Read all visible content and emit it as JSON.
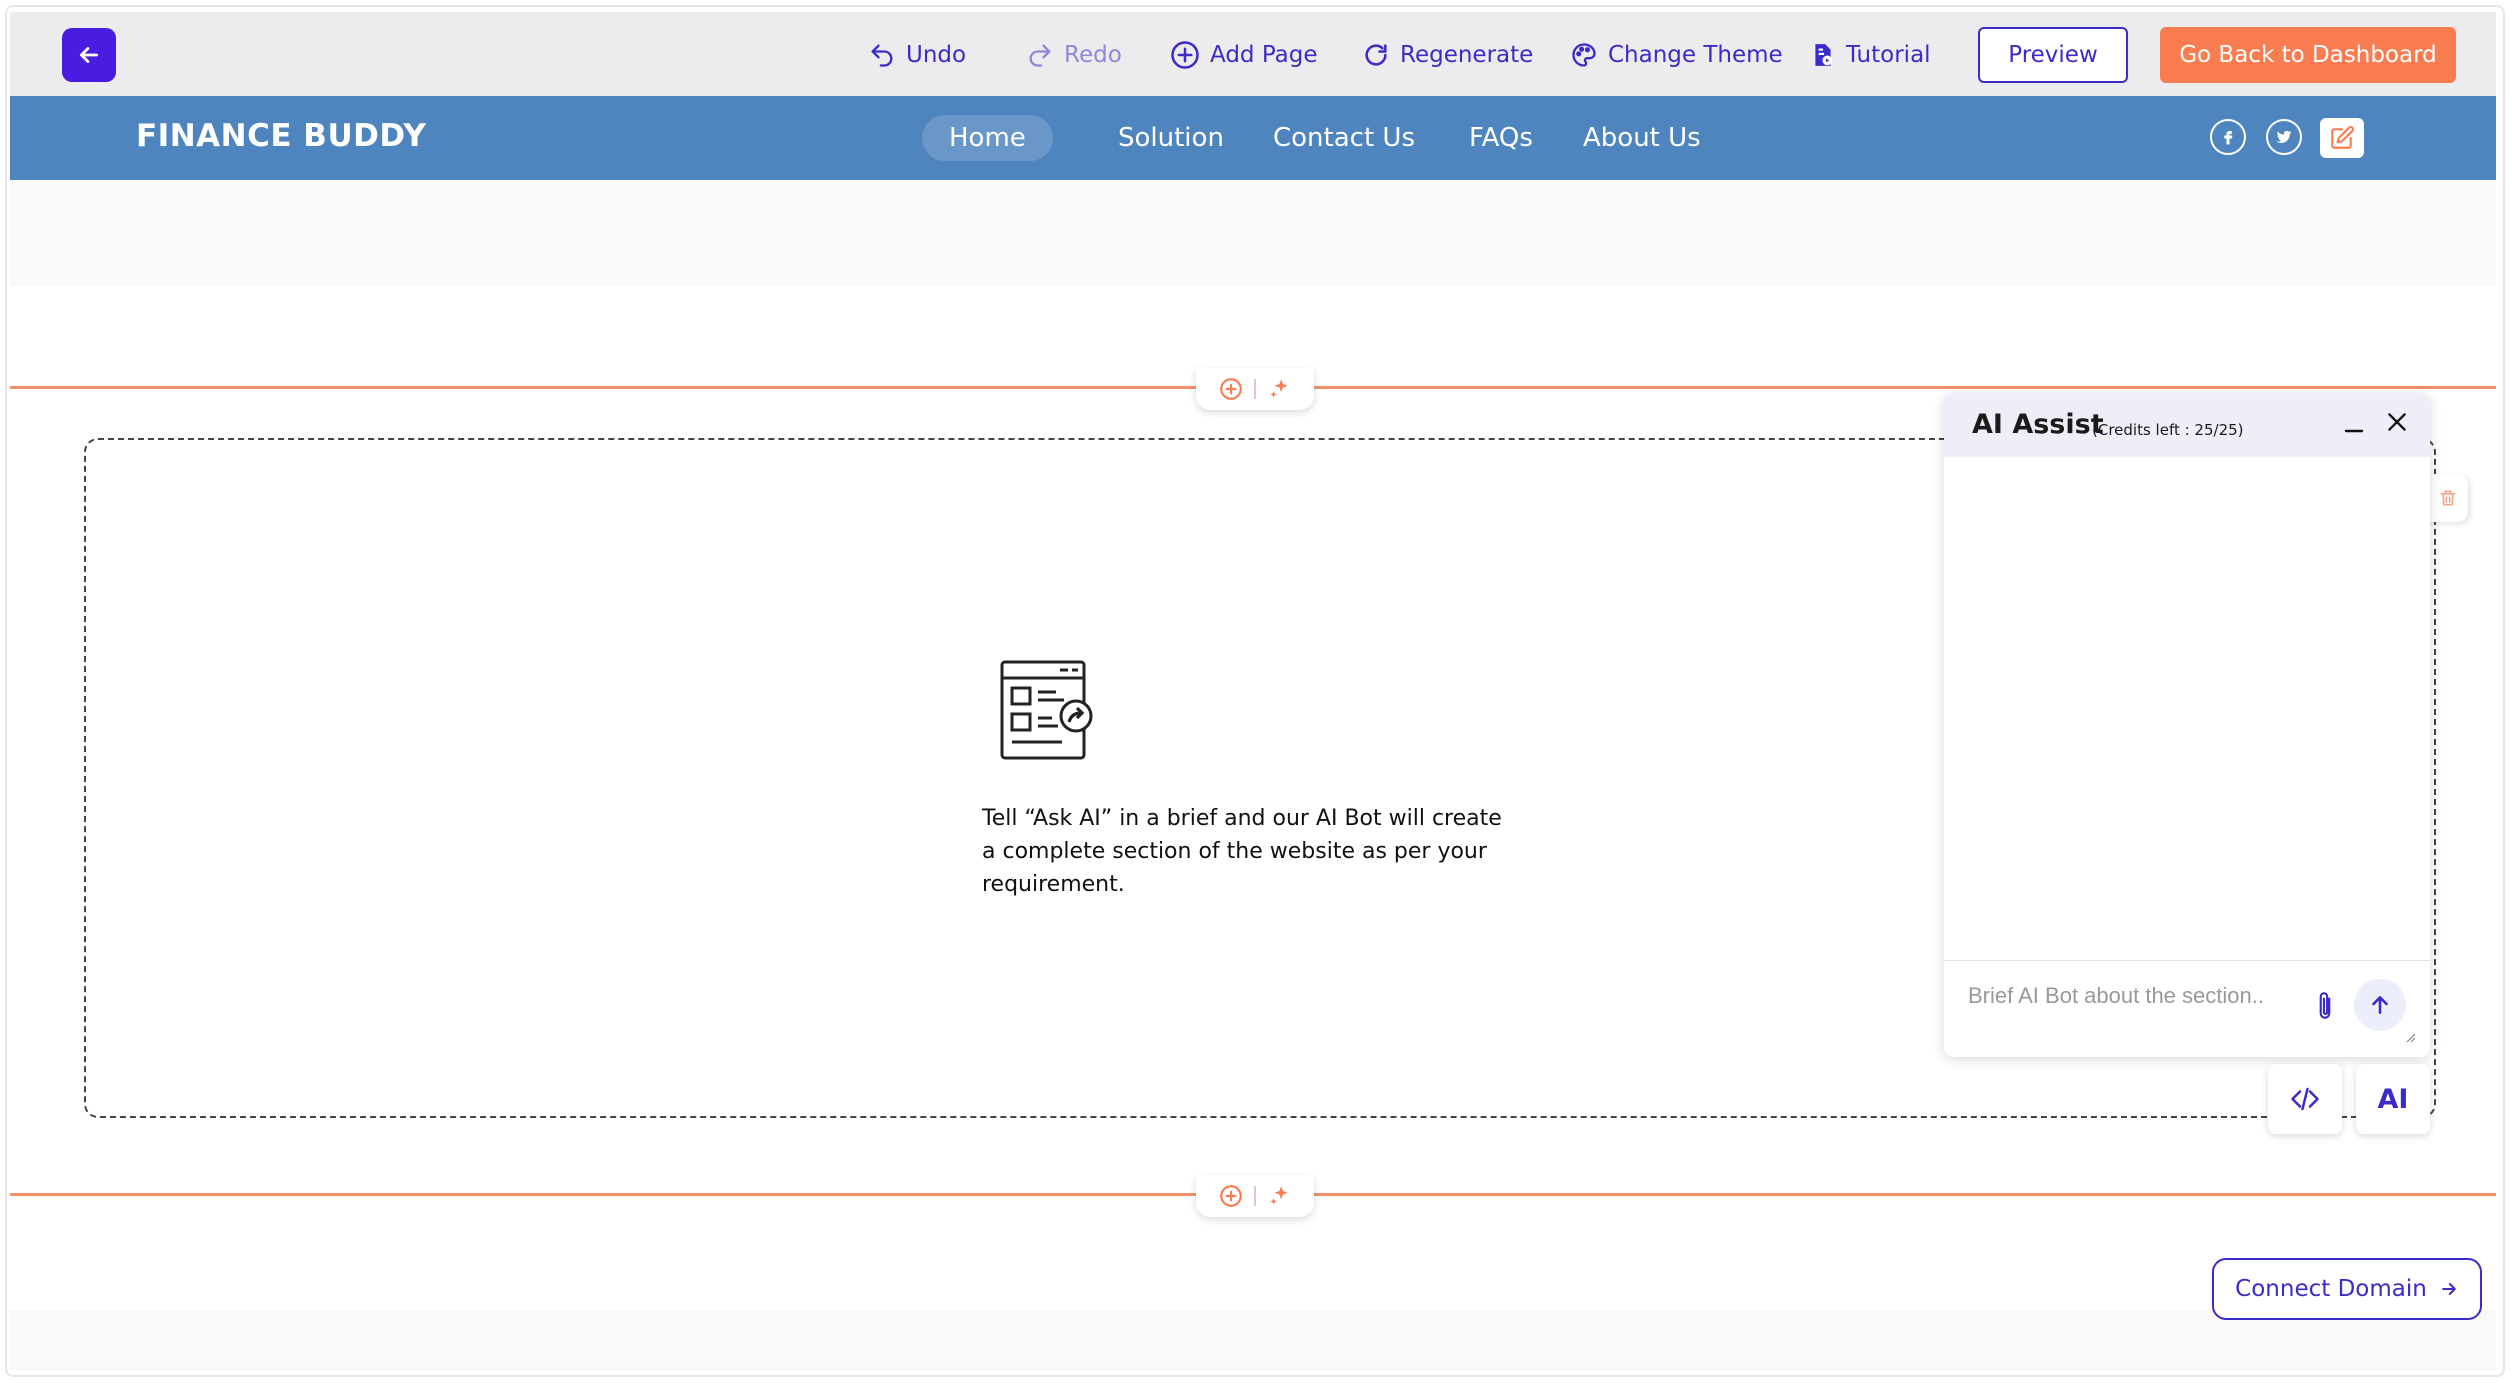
{
  "toolbar": {
    "undo": "Undo",
    "redo": "Redo",
    "add_page": "Add Page",
    "regenerate": "Regenerate",
    "change_theme": "Change Theme",
    "tutorial": "Tutorial",
    "preview": "Preview",
    "go_back": "Go Back to Dashboard"
  },
  "site": {
    "brand": "FINANCE BUDDY",
    "nav": [
      "Home",
      "Solution",
      "Contact Us",
      "FAQs",
      "About Us"
    ],
    "active_nav": "Home"
  },
  "section": {
    "empty_text": "Tell “Ask AI” in a brief and our AI Bot will create a complete section of the website as per your requirement."
  },
  "ai_panel": {
    "title": "AI Assist",
    "credits": "(Credits left : 25/25)",
    "input_placeholder": "Brief AI Bot about the section.."
  },
  "mini_buttons": {
    "ai_label": "AI"
  },
  "footer": {
    "connect_domain": "Connect Domain"
  },
  "colors": {
    "brand_purple": "#4a1be0",
    "link_blue": "#3b2bc9",
    "accent_orange": "#fa7d52",
    "nav_blue": "#4f85bf"
  }
}
